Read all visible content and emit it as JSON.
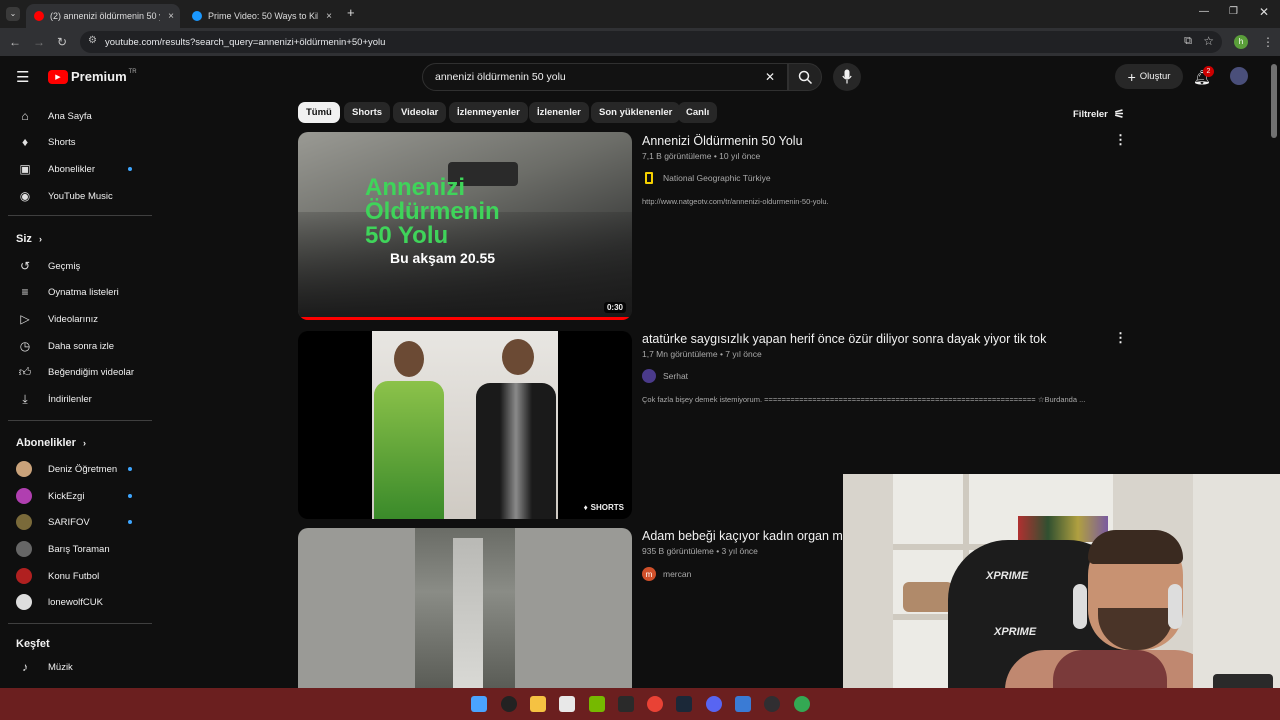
{
  "browser": {
    "tabs": [
      {
        "title": "(2) annenizi öldürmenin 50 yolu",
        "close": "×"
      },
      {
        "title": "Prime Video: 50 Ways to Kill Yo",
        "close": "×"
      }
    ],
    "new_tab": "+",
    "url": "youtube.com/results?search_query=annenizi+öldürmenin+50+yolu",
    "profile_initial": "h"
  },
  "youtube": {
    "logo": "Premium",
    "logo_region": "TR",
    "search_query": "annenizi öldürmenin 50 yolu",
    "create_label": "Oluştur",
    "notif_count": "2"
  },
  "sidebar": {
    "main": [
      {
        "label": "Ana Sayfa",
        "icon": "home-icon"
      },
      {
        "label": "Shorts",
        "icon": "shorts-icon"
      },
      {
        "label": "Abonelikler",
        "icon": "subscriptions-icon"
      },
      {
        "label": "YouTube Music",
        "icon": "music-icon"
      }
    ],
    "you_header": "Siz",
    "you": [
      {
        "label": "Geçmiş",
        "icon": "history-icon"
      },
      {
        "label": "Oynatma listeleri",
        "icon": "playlist-icon"
      },
      {
        "label": "Videolarınız",
        "icon": "video-icon"
      },
      {
        "label": "Daha sonra izle",
        "icon": "clock-icon"
      },
      {
        "label": "Beğendiğim videolar",
        "icon": "like-icon"
      },
      {
        "label": "İndirilenler",
        "icon": "download-icon"
      }
    ],
    "subs_header": "Abonelikler",
    "subs": [
      {
        "label": "Deniz Öğretmen",
        "color": "#c9a27a"
      },
      {
        "label": "KickEzgi",
        "color": "#b03fb0"
      },
      {
        "label": "SARIFOV",
        "color": "#7a6a3a"
      },
      {
        "label": "Barış Toraman",
        "color": "#666666"
      },
      {
        "label": "Konu Futbol",
        "color": "#b02020"
      },
      {
        "label": "lonewolfCUK",
        "color": "#dddddd"
      }
    ],
    "explore_header": "Keşfet",
    "explore": [
      {
        "label": "Müzik",
        "icon": "music-note-icon"
      }
    ]
  },
  "chips": [
    "Tümü",
    "Shorts",
    "Videolar",
    "İzlenmeyenler",
    "İzlenenler",
    "Son yüklenenler",
    "Canlı"
  ],
  "filters_label": "Filtreler",
  "results": [
    {
      "title": "Annenizi Öldürmenin 50 Yolu",
      "meta": "7,1 B görüntüleme • 10 yıl önce",
      "channel": "National Geographic Türkiye",
      "desc": "http://www.natgeotv.com/tr/annenizi-oldurmenin-50-yolu.",
      "duration": "0:30",
      "thumb_text": [
        "Annenizi",
        "Öldürmenin",
        "50 Yolu"
      ],
      "thumb_sub": "Bu akşam 20.55"
    },
    {
      "title": "atatürke saygısızlık yapan herif önce özür diliyor sonra dayak yiyor tik tok",
      "meta": "1,7 Mn görüntüleme • 7 yıl önce",
      "channel": "Serhat",
      "desc": "Çok fazla bişey demek istemiyorum. ============================================================== ☆Burdanda ...",
      "badge": "SHORTS"
    },
    {
      "title": "Adam bebeği kaçıyor kadın organ maf",
      "meta": "935 B görüntüleme • 3 yıl önce",
      "channel": "mercan",
      "channel_initial": "m"
    }
  ],
  "webcam": {
    "brand1": "XPRIME",
    "brand2": "XPRIME"
  }
}
